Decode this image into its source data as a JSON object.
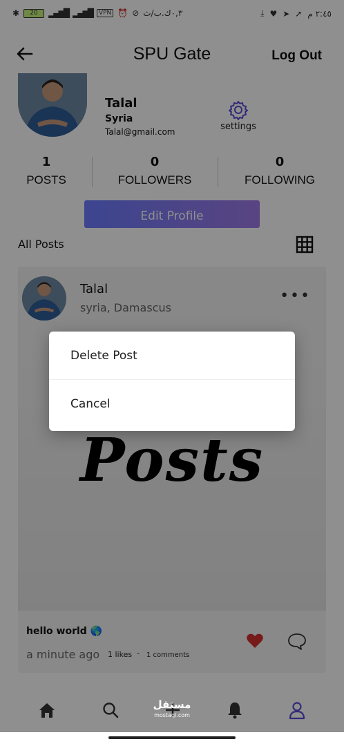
{
  "status_bar": {
    "battery": "20",
    "vpn": "VPN",
    "carrier_text": "٠,٣ك.ب/ث",
    "time": "٢:٤٥ م"
  },
  "header": {
    "title": "SPU Gate",
    "logout_label": "Log Out",
    "back_icon": "arrow-left-icon"
  },
  "profile": {
    "name": "Talal",
    "country": "Syria",
    "email": "Talal@gmail.com",
    "settings_label": "settings",
    "settings_icon": "gear-icon"
  },
  "stats": [
    {
      "value": "1",
      "label": "POSTS"
    },
    {
      "value": "0",
      "label": "FOLLOWERS"
    },
    {
      "value": "0",
      "label": "FOLLOWING"
    }
  ],
  "edit_profile_label": "Edit Profile",
  "all_posts_label": "All Posts",
  "post": {
    "author": "Talal",
    "location": "syria, Damascus",
    "more": "•••",
    "image_text": "Posts",
    "caption": "hello world 🌎",
    "time": "a minute ago",
    "likes": "1 likes",
    "separator": "-",
    "comments": "1 comments"
  },
  "dialog": {
    "delete_label": "Delete Post",
    "cancel_label": "Cancel"
  },
  "watermark": {
    "main": "مستقل",
    "sub": "mostaql.com"
  },
  "colors": {
    "accent": "#6b7cff",
    "accent_end": "#9f7ae8",
    "heart": "#d32f2f",
    "nav_active": "#5b4bd6"
  }
}
